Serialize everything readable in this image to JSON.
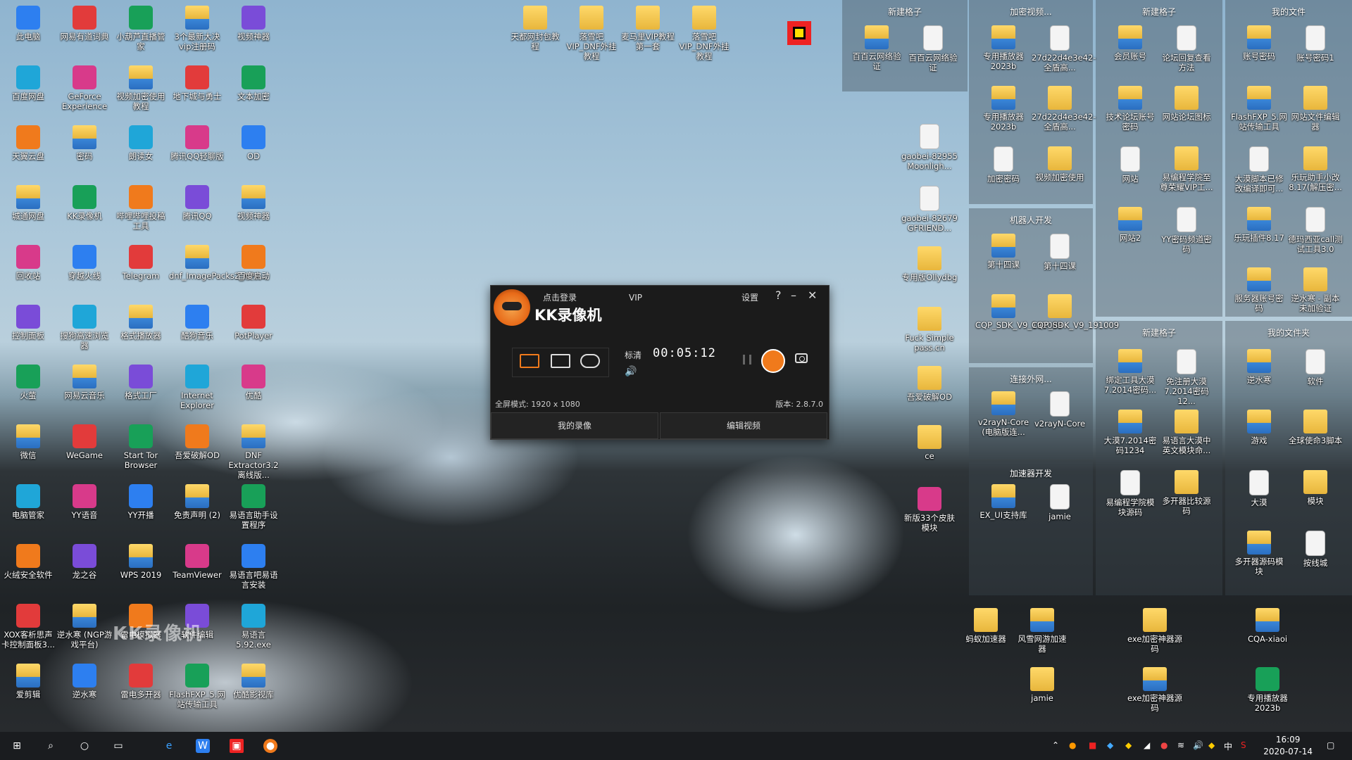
{
  "desktop_left": [
    [
      "此电脑",
      "网易有道词典",
      "小葫芦直播管家",
      "3个最新大决vip注册码",
      "视频神器"
    ],
    [
      "百度网盘",
      "GeForce Experience",
      "视频加密使用教程",
      "地下城与勇士",
      "文本加密"
    ],
    [
      "天翼云盘",
      "密码",
      "朗读女",
      "腾讯QQ轻聊版",
      "OD"
    ],
    [
      "城通网盘",
      "KK录像机",
      "哔哩哔哩投稿工具",
      "腾讯QQ",
      "视频神器"
    ],
    [
      "回收站",
      "穿越火线",
      "Telegram",
      "dnf_ImagePacks2_NPK...",
      "百度启动"
    ],
    [
      "控制面板",
      "搜狗高速浏览器",
      "格式播放器",
      "酷狗音乐",
      "PotPlayer"
    ],
    [
      "火萤",
      "网易云音乐",
      "格式工厂",
      "Internet Explorer",
      "优酷"
    ],
    [
      "微信",
      "WeGame",
      "Start Tor Browser",
      "吾爱破解OD",
      "DNF Extractor3.2离线版..."
    ],
    [
      "电脑管家",
      "YY语音",
      "YY开播",
      "免责声明 (2)",
      "易语言助手设置程序"
    ],
    [
      "火绒安全软件",
      "龙之谷",
      "WPS 2019",
      "TeamViewer",
      "易语言吧易语言安装"
    ],
    [
      "XOX客析思声卡控制面板3...",
      "逆水寒 (NGP游戏平台)",
      "雷电模拟器",
      "软件编辑",
      "易语言5.92.exe"
    ],
    [
      "爱剪辑",
      "逆水寒",
      "雷电多开器",
      "FlashFXP_5.网站传输工具",
      "优酷影视库"
    ]
  ],
  "desktop_top_middle": [
    "天都网封包教程",
    "落雪吧VIP_DNF外挂教程",
    "麦马里VIP教程第一套",
    "落雪吧VIP_DNF外挂教程"
  ],
  "desktop_mid_column": [
    "gaobei-82955 Moonligh...",
    "gaobei-82679 GFRIEND...",
    "专用版Ollydbg",
    "Fuck Simple pass.cn",
    "吾爱破解OD",
    "ce",
    "新版33个皮肤模块"
  ],
  "fences": [
    {
      "title": "新建格子",
      "items": [
        "百百云网络验证",
        "百百云网络验证"
      ]
    },
    {
      "title": "加密视频...",
      "items": [
        "专用播放器2023b",
        "27d22d4e3e42-全盾高...",
        "专用播放器2023b",
        "27d22d4e3e42-全盾高...",
        "加密密码",
        "视频加密使用"
      ]
    },
    {
      "title": "新建格子",
      "items": [
        "会员账号",
        "论坛回复查看方法",
        "技术论坛账号密码",
        "网站论坛图标",
        "网站",
        "易编程学院至尊荣耀VIP工...",
        "网站2",
        "YY密码频道密码"
      ]
    },
    {
      "title": "我的文件",
      "items": [
        "账号密码",
        "账号密码1",
        "FlashFXP_5.网站传输工具",
        "网站文件编辑器",
        "大漠脚本已修改编译即可...",
        "乐玩助手小改8.17(解压密...",
        "乐玩插件8.17",
        "德玛西亚call测试工具3.0",
        "服务器账号密码",
        "逆水寒 - 副本未加验证"
      ]
    },
    {
      "title": "机器人开发",
      "items": [
        "第十四课",
        "第十四课",
        "CQP_SDK_V9_191009",
        "CQP_SDK_V9_191009"
      ]
    },
    {
      "title": "连接外网...",
      "items": [
        "v2rayN-Core (电脑版连...",
        "v2rayN-Core"
      ]
    },
    {
      "title": "加速器开发",
      "items": [
        "EX_UI支持库",
        "jamie"
      ]
    },
    {
      "title": "新建格子",
      "items": [
        "绑定工具大漠7.2014密码...",
        "免注册大漠7.2014密码12...",
        "大漠7.2014密码1234",
        "易语言大漠中英文模块命...",
        "易编程学院模块源码",
        "多开器比较源码"
      ]
    },
    {
      "title": "我的文件夹",
      "items": [
        "逆水寒",
        "软件",
        "游戏",
        "全球使命3脚本",
        "大漠",
        "模块",
        "多开器源码模块",
        "按线城"
      ]
    }
  ],
  "desktop_bottom_right": [
    "蚂蚁加速器",
    "风雪网游加速器",
    "exe加密神器源码",
    "CQA-xiaoi",
    "jamie",
    "exe加密神器源码",
    "专用播放器2023b"
  ],
  "recorder": {
    "brand": "KK录像机",
    "login": "点击登录",
    "vip": "VIP",
    "settings": "设置",
    "help": "?",
    "minimize": "–",
    "close": "✕",
    "quality": "标清",
    "timer": "00:05:12",
    "mode_info": "全屏模式: 1920 x 1080",
    "version": "版本: 2.8.7.0",
    "my_recordings": "我的录像",
    "edit_video": "编辑视频"
  },
  "watermark": "KK录像机",
  "taskbar": {
    "time": "16:09",
    "date": "2020-07-14",
    "ime": "中",
    "icons": [
      "windows-icon",
      "search-icon",
      "cortana-icon",
      "task-view-icon",
      "edge-icon",
      "wps-icon",
      "app-icon",
      "kk-recorder-icon"
    ]
  }
}
